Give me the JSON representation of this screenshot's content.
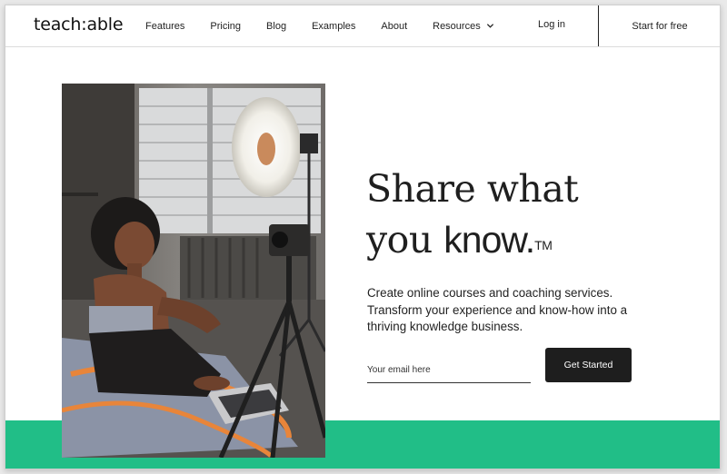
{
  "header": {
    "logo": "teach:able",
    "nav": [
      {
        "label": "Features"
      },
      {
        "label": "Pricing"
      },
      {
        "label": "Blog"
      },
      {
        "label": "Examples"
      },
      {
        "label": "About"
      },
      {
        "label": "Resources",
        "icon": "chevron-down-icon"
      }
    ],
    "login": "Log in",
    "start_free": "Start for free"
  },
  "hero": {
    "title_line1": "Share what",
    "title_line2_prefix": "you ",
    "title_emphasis": "know.",
    "trademark": "TM",
    "subtitle": "Create online courses and coaching services. Transform your experience and know-how into a thriving knowledge business.",
    "email_placeholder": "Your email here",
    "cta": "Get Started"
  },
  "colors": {
    "accent_green": "#21be87",
    "button_dark": "#1e1e1e"
  }
}
